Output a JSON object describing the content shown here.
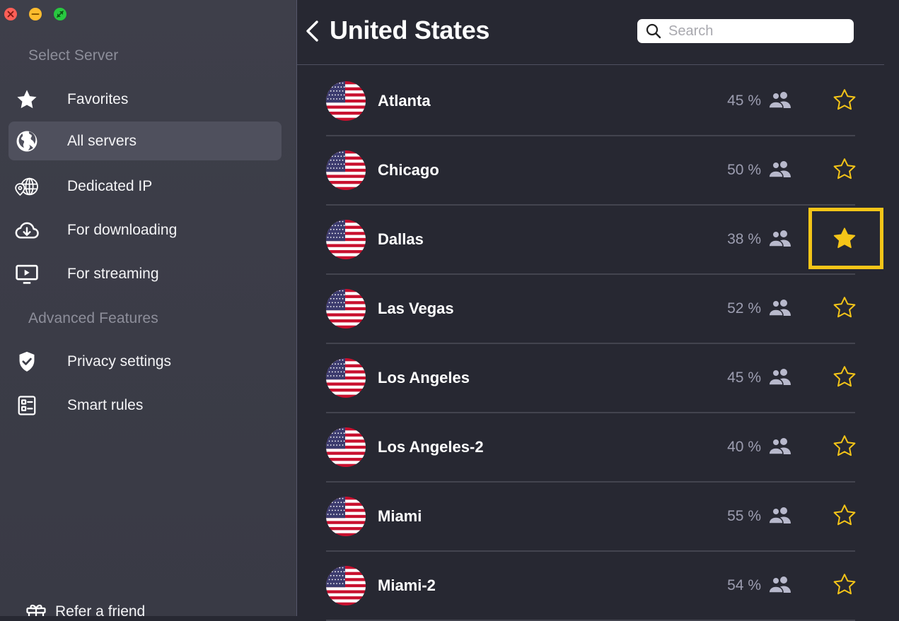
{
  "window": {
    "controls": [
      "close-icon",
      "minimize-icon",
      "zoom-icon"
    ]
  },
  "sidebar": {
    "section_select": "Select Server",
    "items": [
      {
        "label": "Favorites",
        "icon": "star-icon"
      },
      {
        "label": "All servers",
        "icon": "globe-icon",
        "active": true
      },
      {
        "label": "Dedicated IP",
        "icon": "dedicated-ip-icon"
      },
      {
        "label": "For downloading",
        "icon": "cloud-download-icon"
      },
      {
        "label": "For streaming",
        "icon": "tv-icon"
      }
    ],
    "section_advanced": "Advanced Features",
    "advanced_items": [
      {
        "label": "Privacy settings",
        "icon": "shield-check-icon"
      },
      {
        "label": "Smart rules",
        "icon": "rules-icon"
      }
    ],
    "bottom_label": "Refer a friend"
  },
  "header": {
    "title": "United States",
    "search_placeholder": "Search"
  },
  "servers": [
    {
      "city": "Atlanta",
      "load": "45 %",
      "favorite": false
    },
    {
      "city": "Chicago",
      "load": "50 %",
      "favorite": false
    },
    {
      "city": "Dallas",
      "load": "38 %",
      "favorite": true
    },
    {
      "city": "Las Vegas",
      "load": "52 %",
      "favorite": false
    },
    {
      "city": "Los Angeles",
      "load": "45 %",
      "favorite": false
    },
    {
      "city": "Los Angeles-2",
      "load": "40 %",
      "favorite": false
    },
    {
      "city": "Miami",
      "load": "55 %",
      "favorite": false
    },
    {
      "city": "Miami-2",
      "load": "54 %",
      "favorite": false
    }
  ],
  "colors": {
    "accent_star": "#f5c518",
    "sidebar_bg": "#3d3e49",
    "main_bg": "#272832",
    "active_item": "#4f505d"
  }
}
